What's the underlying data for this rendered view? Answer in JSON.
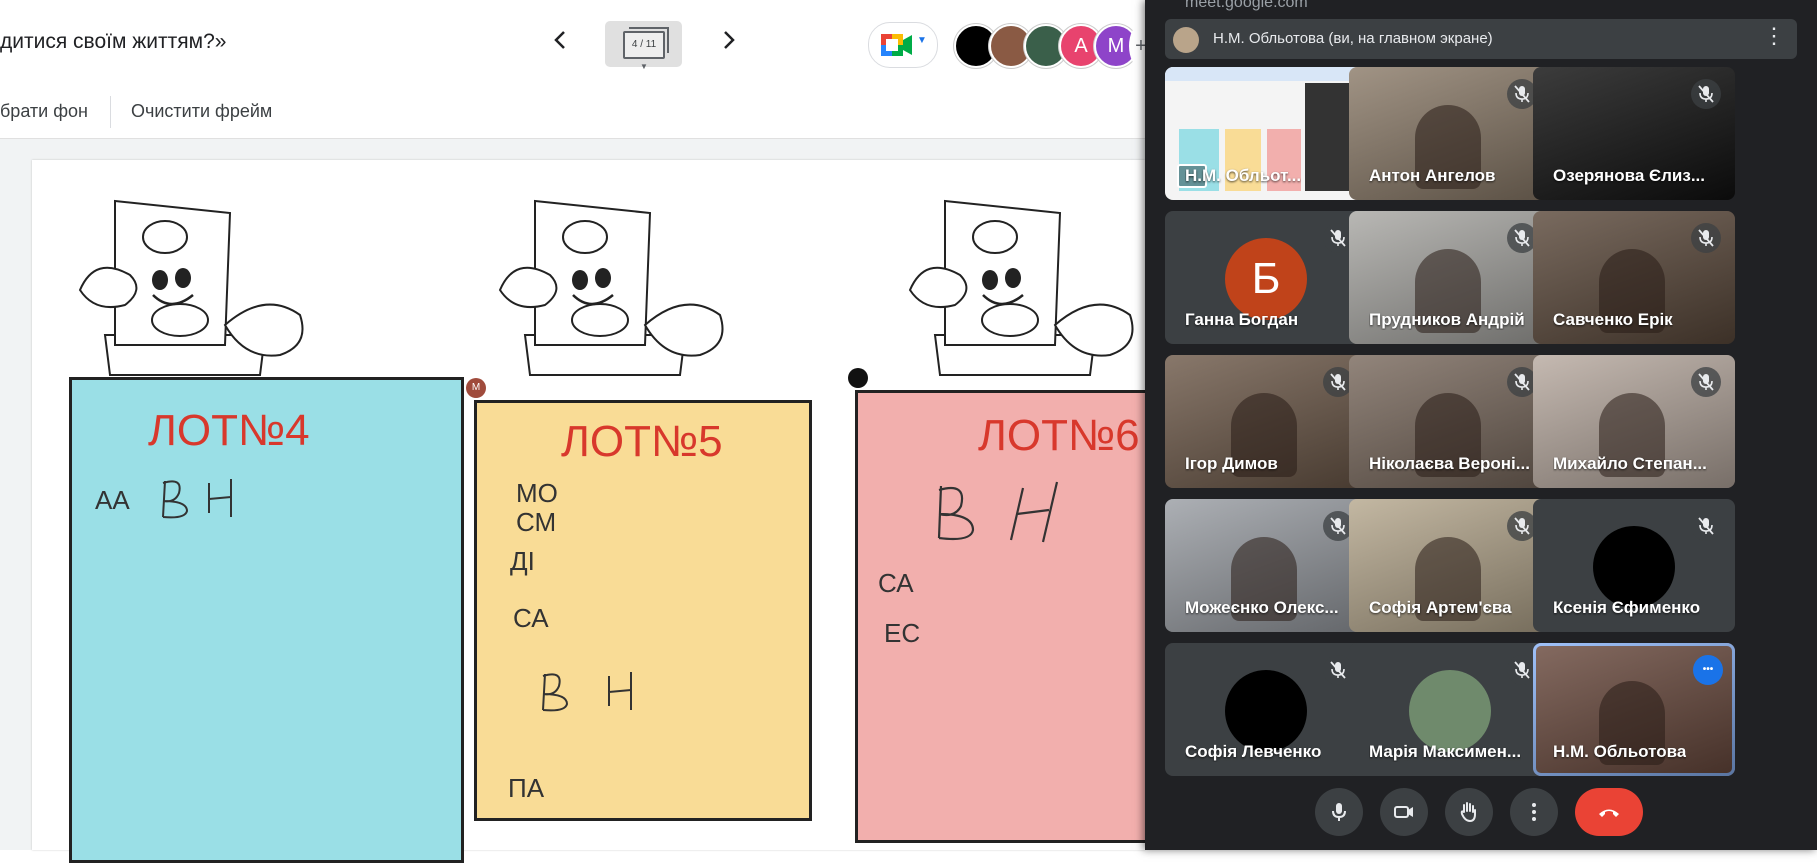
{
  "jamboard": {
    "title": "дитися своїм життям?»",
    "frame_indicator": "4 / 11",
    "toolbar": {
      "set_background": "брати фон",
      "clear_frame": "Очистити фрейм"
    },
    "participants_avatars": [
      {
        "initial": "",
        "color": "#000000"
      },
      {
        "initial": "",
        "color": "#8a5a44"
      },
      {
        "initial": "",
        "color": "#3a5f4a"
      },
      {
        "initial": "A",
        "color": "#e8436e"
      },
      {
        "initial": "M",
        "color": "#8e44c9"
      }
    ],
    "avatars_more": "+",
    "notes": [
      {
        "title": "ЛОТ№4",
        "color": "#9adfe6",
        "lines": [
          "АА"
        ],
        "handwriting": "ВН"
      },
      {
        "title": "ЛОТ№5",
        "color": "#f9dc96",
        "lines": [
          "МО",
          "СМ",
          "ДІ",
          "СА",
          "ПА"
        ],
        "handwriting": "ВН"
      },
      {
        "title": "ЛОТ№6",
        "color": "#f2afad",
        "lines": [
          "СА",
          "ЕС"
        ],
        "handwriting": "ВН"
      }
    ],
    "cursor_label": "M"
  },
  "meet": {
    "url": "meet.google.com",
    "presenter_bar": "Н.М. Обльотова (ви, на главном экране)",
    "tiles": [
      {
        "name": "Н.М. Обльот...",
        "type": "screen",
        "muted": false
      },
      {
        "name": "Антон Ангелов",
        "type": "video",
        "bg": "#8c7c6a",
        "muted": true
      },
      {
        "name": "Озерянова Єлиз...",
        "type": "dark",
        "bg": "#111111",
        "muted": true
      },
      {
        "name": "Ганна Богдан",
        "type": "initial",
        "initial": "Б",
        "bg": "#3c4043",
        "circle": "#c0431a",
        "muted": true
      },
      {
        "name": "Прудников Андрій",
        "type": "video",
        "bg": "#a9a8a4",
        "muted": true
      },
      {
        "name": "Савченко Ерік",
        "type": "video",
        "bg": "#5c4a3c",
        "muted": true
      },
      {
        "name": "Ігор Димов",
        "type": "video",
        "bg": "#6e5a4a",
        "muted": true
      },
      {
        "name": "Ніколаєва Вероні...",
        "type": "video",
        "bg": "#7a6a5e",
        "muted": true
      },
      {
        "name": "Михайло Степан...",
        "type": "video",
        "bg": "#b8aaa0",
        "muted": true
      },
      {
        "name": "Можеєнко Олекс...",
        "type": "video",
        "bg": "#9a9ea4",
        "muted": true
      },
      {
        "name": "Софія Артем'єва",
        "type": "video",
        "bg": "#b6a88e",
        "muted": true
      },
      {
        "name": "Ксенія Єфименко",
        "type": "initial",
        "initial": "",
        "bg": "#3c4043",
        "circle": "#000000",
        "muted": true
      },
      {
        "name": "Софія Левченко",
        "type": "initial",
        "initial": "",
        "bg": "#3c4043",
        "circle": "#000000",
        "muted": true
      },
      {
        "name": "Марія Максимен...",
        "type": "photo",
        "bg": "#3c4043",
        "circle": "#6f8a6c",
        "muted": true
      },
      {
        "name": "Н.М. Обльотова",
        "type": "video",
        "bg": "#6a4a3e",
        "muted": false,
        "active": true
      }
    ],
    "controls": [
      "mic-icon",
      "camera-icon",
      "raise-hand-icon",
      "more-options-icon",
      "end-call-icon"
    ]
  }
}
